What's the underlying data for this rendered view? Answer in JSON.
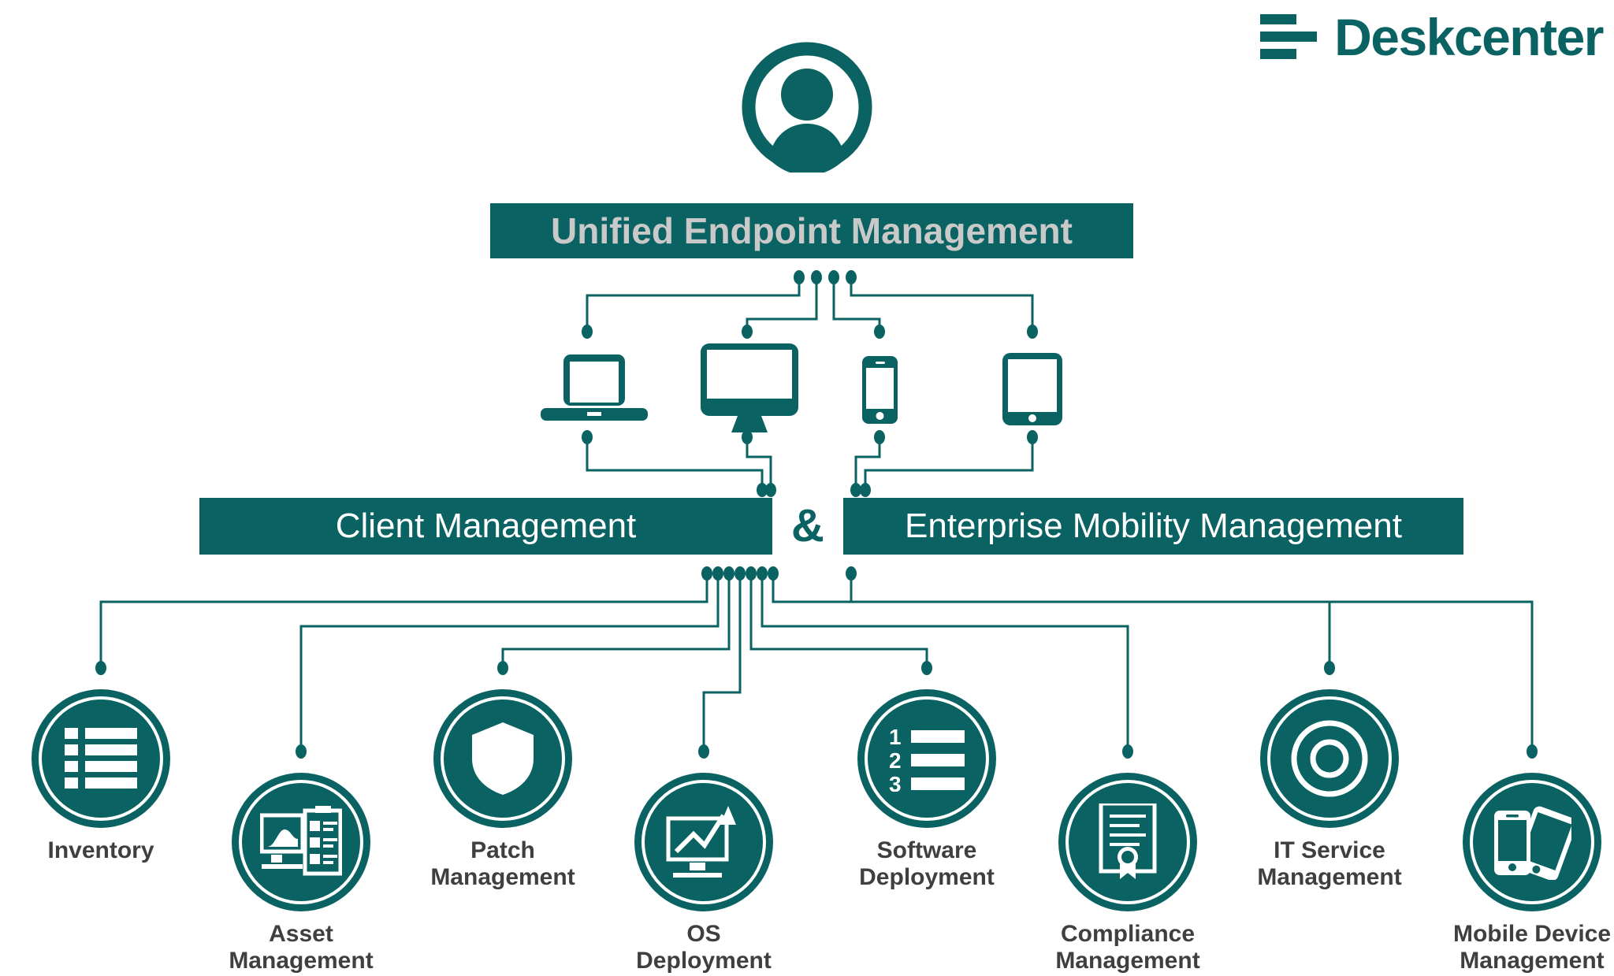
{
  "brand": {
    "name": "Deskcenter",
    "mark_icon": "deskcenter-bars-logo-icon",
    "color": "#0a6262"
  },
  "colors": {
    "teal": "#0a6262",
    "title_text": "#c9c9c9",
    "bar_text": "#ffffff",
    "label_text": "#3f3f3f",
    "background": "#ffffff"
  },
  "top": {
    "avatar_icon": "person-avatar-icon",
    "title": "Unified Endpoint Management"
  },
  "devices": [
    {
      "icon": "laptop-icon",
      "name": "laptop"
    },
    {
      "icon": "desktop-icon",
      "name": "desktop-monitor"
    },
    {
      "icon": "phone-icon",
      "name": "smartphone"
    },
    {
      "icon": "tablet-icon",
      "name": "tablet"
    }
  ],
  "branches": {
    "left_label": "Client Management",
    "separator": "&",
    "right_label": "Enterprise Mobility Management"
  },
  "modules": [
    {
      "label": "Inventory",
      "icon": "list-icon",
      "icon_name": "inventory"
    },
    {
      "label": "Asset\nManagement",
      "icon": "monitor-clipboard-icon",
      "icon_name": "asset-management"
    },
    {
      "label": "Patch\nManagement",
      "icon": "shield-icon",
      "icon_name": "patch-management"
    },
    {
      "label": "OS\nDeployment",
      "icon": "monitor-chart-icon",
      "icon_name": "os-deployment"
    },
    {
      "label": "Software\nDeployment",
      "icon": "numbered-list-icon",
      "icon_name": "software-deployment"
    },
    {
      "label": "Compliance\nManagement",
      "icon": "certificate-icon",
      "icon_name": "compliance-management"
    },
    {
      "label": "IT Service\nManagement",
      "icon": "lifebuoy-icon",
      "icon_name": "it-service-management"
    },
    {
      "label": "Mobile Device\nManagement",
      "icon": "phone-tablet-icon",
      "icon_name": "mobile-device-management"
    }
  ]
}
